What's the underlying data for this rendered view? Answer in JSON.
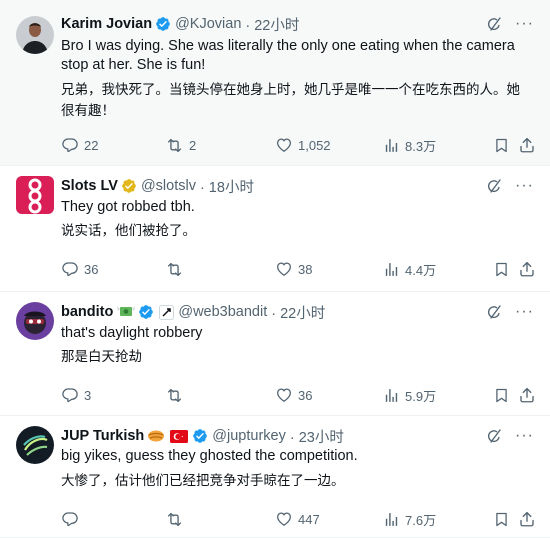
{
  "colors": {
    "verified": "#1d9bf0",
    "gold": "#e2b719",
    "text": "#0f1419",
    "muted": "#536471"
  },
  "tweets": [
    {
      "name": "Karim Jovian",
      "badge": "blue-verified",
      "handle": "@KJovian",
      "time": "· 22小时",
      "text_en": "Bro I was dying. She was literally the only one eating when the camera stop at her. She is fun!",
      "text_zh": "兄弟，我快死了。当镜头停在她身上时，她几乎是唯一一个在吃东西的人。她很有趣！",
      "replies": "22",
      "retweets": "2",
      "likes": "1,052",
      "views": "8.3万"
    },
    {
      "name": "Slots LV",
      "badge": "gold-verified",
      "handle": "@slotslv",
      "time": "· 18小时",
      "text_en": "They got robbed tbh.",
      "text_zh": "说实话，他们被抢了。",
      "replies": "36",
      "retweets": "",
      "likes": "38",
      "views": "4.4万"
    },
    {
      "name": "bandito",
      "emoji": "money-with-wings",
      "badge": "blue-verified",
      "handle": "@web3bandit",
      "time": "· 22小时",
      "text_en": "that's daylight robbery",
      "text_zh": "那是白天抢劫",
      "replies": "3",
      "retweets": "",
      "likes": "36",
      "views": "5.9万"
    },
    {
      "name": "JUP Turkish",
      "emoji": "jupiter-logo",
      "flag": "turkey-flag",
      "badge": "blue-verified",
      "handle": "@jupturkey",
      "time": "· 23小时",
      "text_en": "big yikes, guess they ghosted the competition.",
      "text_zh": "大惨了，估计他们已经把竞争对手晾在了一边。",
      "replies": "",
      "retweets": "",
      "likes": "447",
      "views": "7.6万"
    }
  ]
}
